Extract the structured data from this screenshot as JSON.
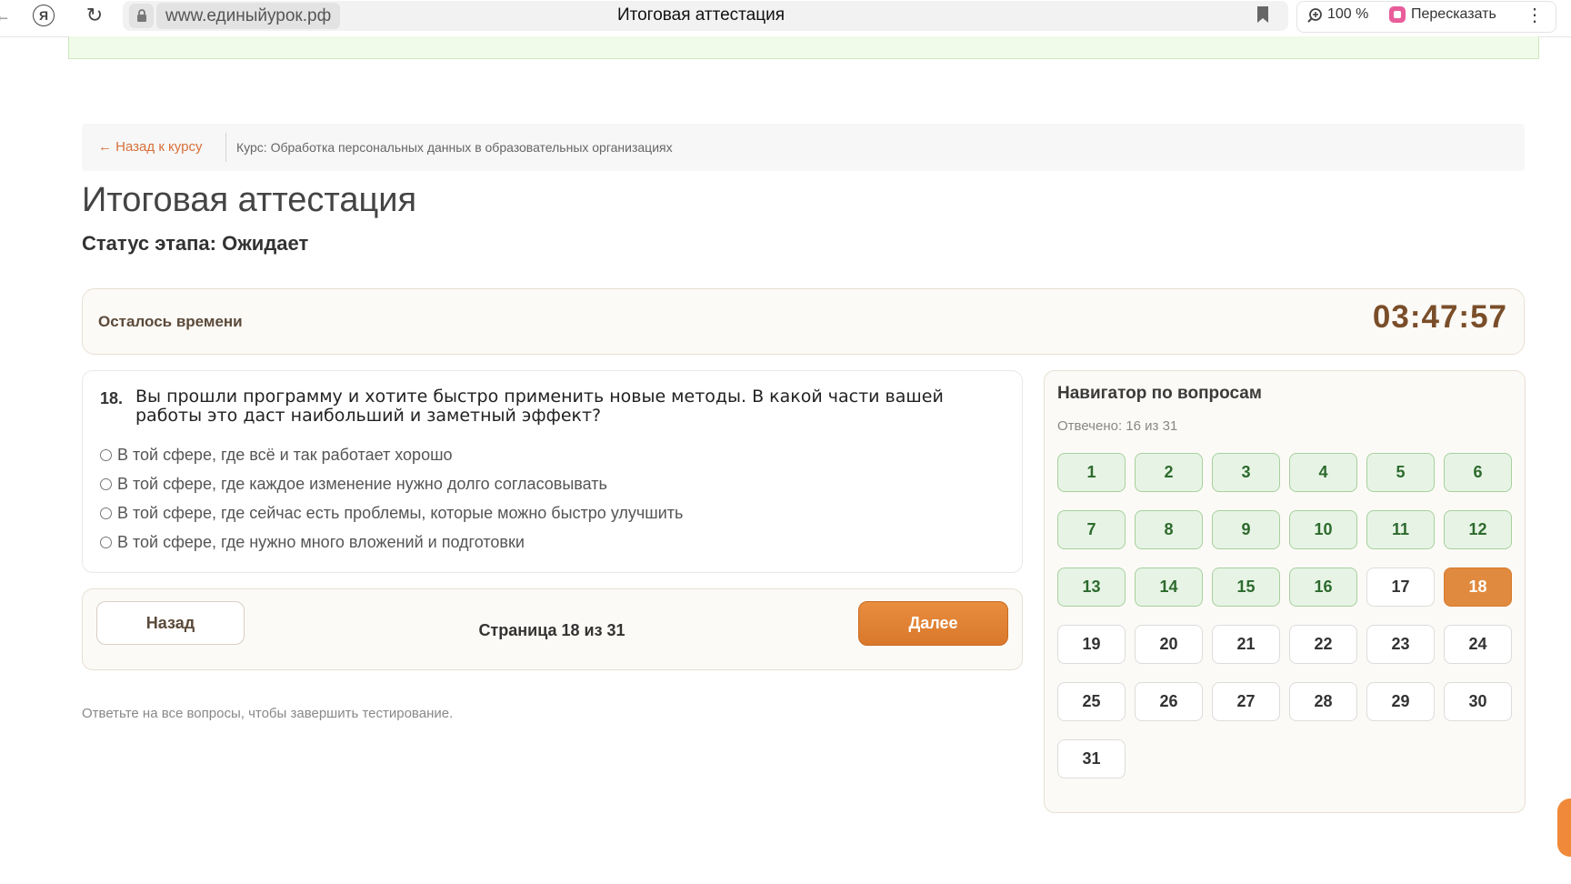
{
  "browser": {
    "url": "www.единыйурок.рф",
    "tab_title": "Итоговая аттестация",
    "zoom": "100 %",
    "retell_label": "Пересказать",
    "back_glyph": "←",
    "ya_glyph": "Я",
    "reload_glyph": "↻",
    "menu_glyph": "⋮"
  },
  "breadcrumb": {
    "back_label": "← Назад к курсу",
    "course": "Курс: Обработка персональных данных в образовательных организациях"
  },
  "page": {
    "title": "Итоговая аттестация",
    "status": "Статус этапа: Ожидает"
  },
  "timer": {
    "label": "Осталось времени",
    "value": "03:47:57"
  },
  "question": {
    "number": "18.",
    "text": "Вы прошли программу и хотите быстро применить новые методы. В какой части вашей работы это даст наибольший и заметный эффект?",
    "options": [
      "В той сфере, где всё и так работает хорошо",
      "В той сфере, где каждое изменение нужно долго согласовывать",
      "В той сфере, где сейчас есть проблемы, которые можно быстро улучшить",
      "В той сфере, где нужно много вложений и подготовки"
    ]
  },
  "navigation": {
    "back_label": "Назад",
    "page_info": "Страница 18 из 31",
    "next_label": "Далее"
  },
  "hint": "Ответьте на все вопросы, чтобы завершить тестирование.",
  "navigator": {
    "title": "Навигатор по вопросам",
    "answered_label": "Отвечено: 16 из 31",
    "total": 31,
    "current": 18,
    "answered": [
      1,
      2,
      3,
      4,
      5,
      6,
      7,
      8,
      9,
      10,
      11,
      12,
      13,
      14,
      15,
      16
    ],
    "colors": {
      "answered_bg": "#e7f4e5",
      "current_bg": "#e08a3f",
      "accent": "#d8703a"
    }
  }
}
